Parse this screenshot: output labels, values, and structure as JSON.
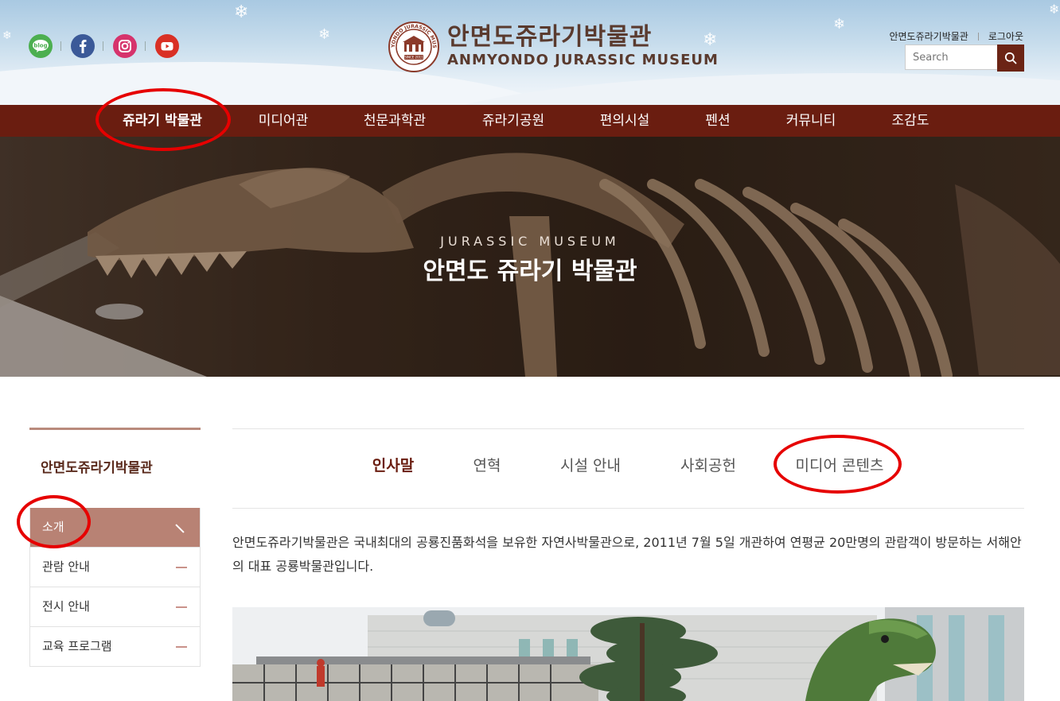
{
  "header": {
    "logo": {
      "title_kr": "안면도쥬라기박물관",
      "title_en": "ANMYONDO JURASSIC MUSEUM",
      "seal_text": "ANMYONDO JURASSIC MUSEUM",
      "seal_since": "SINCE 2011"
    },
    "social": [
      {
        "name": "blog",
        "icon": "blog-icon",
        "label": "blog",
        "color": "#4caf50"
      },
      {
        "name": "facebook",
        "icon": "facebook-icon",
        "color": "#3b5998"
      },
      {
        "name": "instagram",
        "icon": "instagram-icon",
        "color": "#d6336c"
      },
      {
        "name": "youtube",
        "icon": "youtube-icon",
        "color": "#d93025"
      }
    ],
    "top_links": {
      "museum": "안면도쥬라기박물관",
      "logout": "로그아웃"
    },
    "search": {
      "placeholder": "Search",
      "icon": "search-icon"
    }
  },
  "nav": {
    "items": [
      {
        "label": "쥬라기 박물관",
        "active": true
      },
      {
        "label": "미디어관"
      },
      {
        "label": "천문과학관"
      },
      {
        "label": "쥬라기공원"
      },
      {
        "label": "편의시설"
      },
      {
        "label": "펜션"
      },
      {
        "label": "커뮤니티"
      },
      {
        "label": "조감도"
      }
    ]
  },
  "hero": {
    "subtitle": "JURASSIC MUSEUM",
    "title": "안면도 쥬라기 박물관"
  },
  "sidebar": {
    "title": "안면도쥬라기박물관",
    "items": [
      {
        "label": "소개",
        "active": true
      },
      {
        "label": "관람 안내"
      },
      {
        "label": "전시 안내"
      },
      {
        "label": "교육 프로그램"
      }
    ]
  },
  "content": {
    "tabs": [
      {
        "label": "인사말",
        "active": true
      },
      {
        "label": "연혁"
      },
      {
        "label": "시설 안내"
      },
      {
        "label": "사회공헌"
      },
      {
        "label": "미디어 콘텐츠"
      }
    ],
    "intro": "안면도쥬라기박물관은 국내최대의 공룡진품화석을 보유한 자연사박물관으로, 2011년 7월 5일 개관하여 연평균 20만명의 관람객이 방문하는 서해안의 대표 공룡박물관입니다."
  },
  "theme": {
    "brand": "#6a1d10",
    "sidebar_active": "#b88274",
    "annotation": "#e60000"
  }
}
